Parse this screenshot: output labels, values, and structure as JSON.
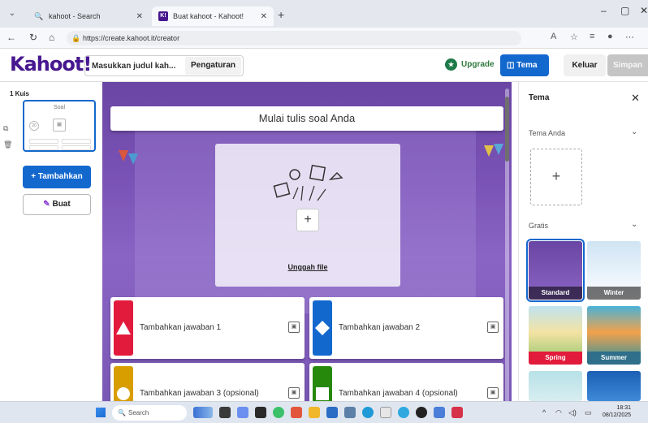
{
  "browser": {
    "tabs": [
      {
        "title": "kahoot - Search"
      },
      {
        "title": "Buat kahoot - Kahoot!"
      }
    ],
    "url": "https://create.kahoot.it/creator"
  },
  "app": {
    "logo": "Kahoot!",
    "title_placeholder": "Masukkan judul kah...",
    "settings_label": "Pengaturan",
    "upgrade_label": "Upgrade",
    "theme_label": "Tema",
    "exit_label": "Keluar",
    "save_label": "Simpan"
  },
  "sidebar": {
    "quiz_label": "1 Kuis",
    "slide_label": "Soal",
    "slide_timer": "20",
    "add_label": "+ Tambahkan",
    "create_label": "Buat"
  },
  "editor": {
    "question_placeholder": "Mulai tulis soal Anda",
    "upload_label": "Unggah file",
    "answers": [
      {
        "label": "Tambahkan jawaban 1",
        "color": "#e21b3c",
        "shape": "triangle"
      },
      {
        "label": "Tambahkan jawaban 2",
        "color": "#1368ce",
        "shape": "diamond"
      },
      {
        "label": "Tambahkan jawaban 3 (opsional)",
        "color": "#d89e00",
        "shape": "circle"
      },
      {
        "label": "Tambahkan jawaban 4 (opsional)",
        "color": "#26890c",
        "shape": "square"
      }
    ]
  },
  "theme_panel": {
    "title": "Tema",
    "your_themes_label": "Tema Anda",
    "free_label": "Gratis",
    "themes": [
      {
        "name": "Standard",
        "selected": true
      },
      {
        "name": "Winter"
      },
      {
        "name": "Spring"
      },
      {
        "name": "Summer"
      }
    ]
  },
  "taskbar": {
    "search_placeholder": "Search",
    "time": "18:31",
    "date": "08/12/2025"
  },
  "colors": {
    "brand_purple": "#46178f",
    "primary_blue": "#1368ce"
  }
}
